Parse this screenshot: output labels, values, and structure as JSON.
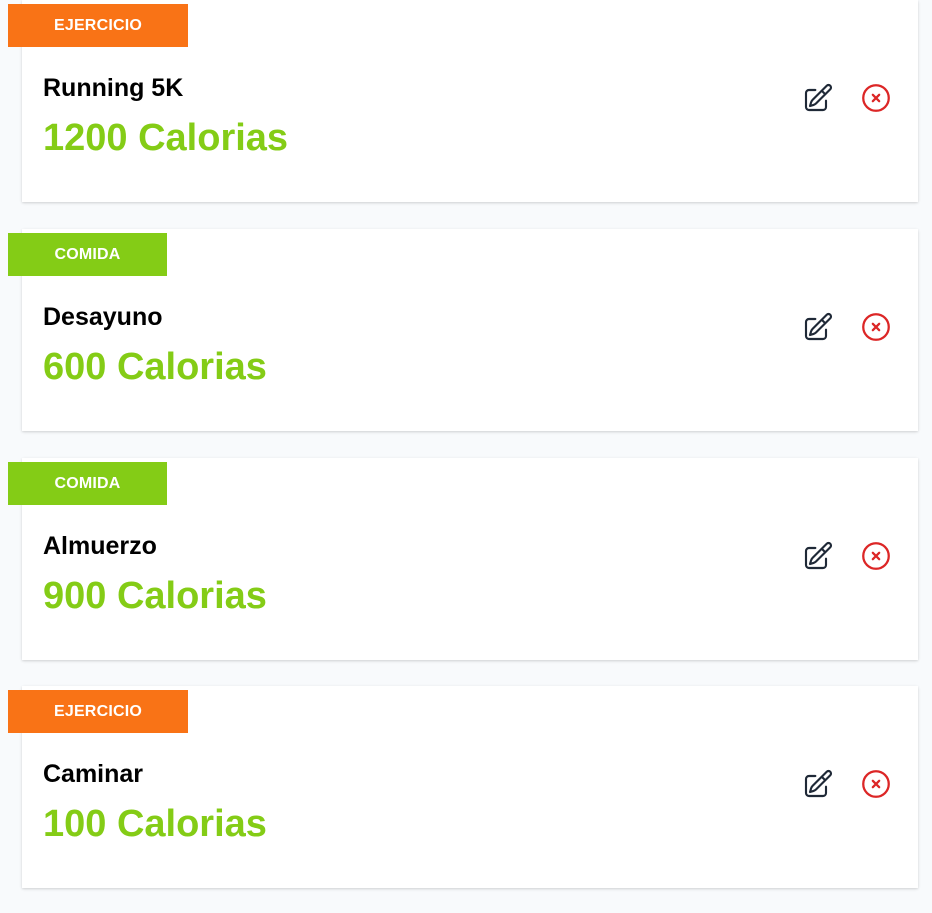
{
  "colors": {
    "ejercicio": "#f97316",
    "comida": "#84cc16",
    "calories_text": "#84cc16",
    "edit_icon": "#1f2937",
    "delete_icon": "#dc2626"
  },
  "entries": [
    {
      "category": "Ejercicio",
      "name": "Running 5K",
      "calories": "1200 Calorias",
      "icons": [
        "pencil-square-icon",
        "x-circle-icon"
      ]
    },
    {
      "category": "Comida",
      "name": "Desayuno",
      "calories": "600 Calorias",
      "icons": [
        "pencil-square-icon",
        "x-circle-icon"
      ]
    },
    {
      "category": "Comida",
      "name": "Almuerzo",
      "calories": "900 Calorias",
      "icons": [
        "pencil-square-icon",
        "x-circle-icon"
      ]
    },
    {
      "category": "Ejercicio",
      "name": "Caminar",
      "calories": "100 Calorias",
      "icons": [
        "pencil-square-icon",
        "x-circle-icon"
      ]
    }
  ]
}
